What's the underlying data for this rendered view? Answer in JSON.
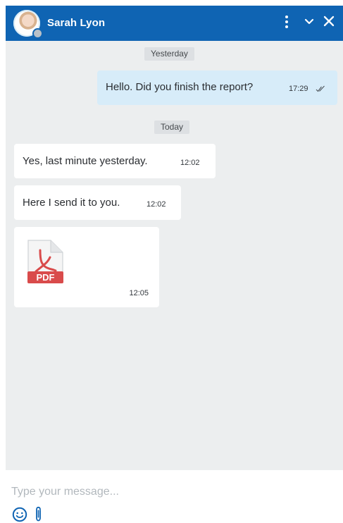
{
  "header": {
    "contact_name": "Sarah Lyon",
    "icons": [
      "more-vertical-icon",
      "chevron-down-icon",
      "close-icon"
    ],
    "bg_color": "#0f64b3"
  },
  "chat": {
    "date_labels": [
      "Yesterday",
      "Today"
    ],
    "messages": [
      {
        "direction": "outgoing",
        "text": "Hello. Did you finish the report?",
        "time": "17:29",
        "status": "read"
      },
      {
        "direction": "incoming",
        "text": "Yes, last minute yesterday.",
        "time": "12:02"
      },
      {
        "direction": "incoming",
        "text": "Here I send it to you.",
        "time": "12:02"
      },
      {
        "direction": "incoming",
        "type": "file",
        "file_type": "PDF",
        "time": "12:05"
      }
    ],
    "bg_color": "#eceeef",
    "outgoing_bubble_color": "#d7ecf9"
  },
  "composer": {
    "placeholder": "Type your message...",
    "value": "",
    "icons": [
      "emoji-icon",
      "attachment-icon"
    ]
  }
}
